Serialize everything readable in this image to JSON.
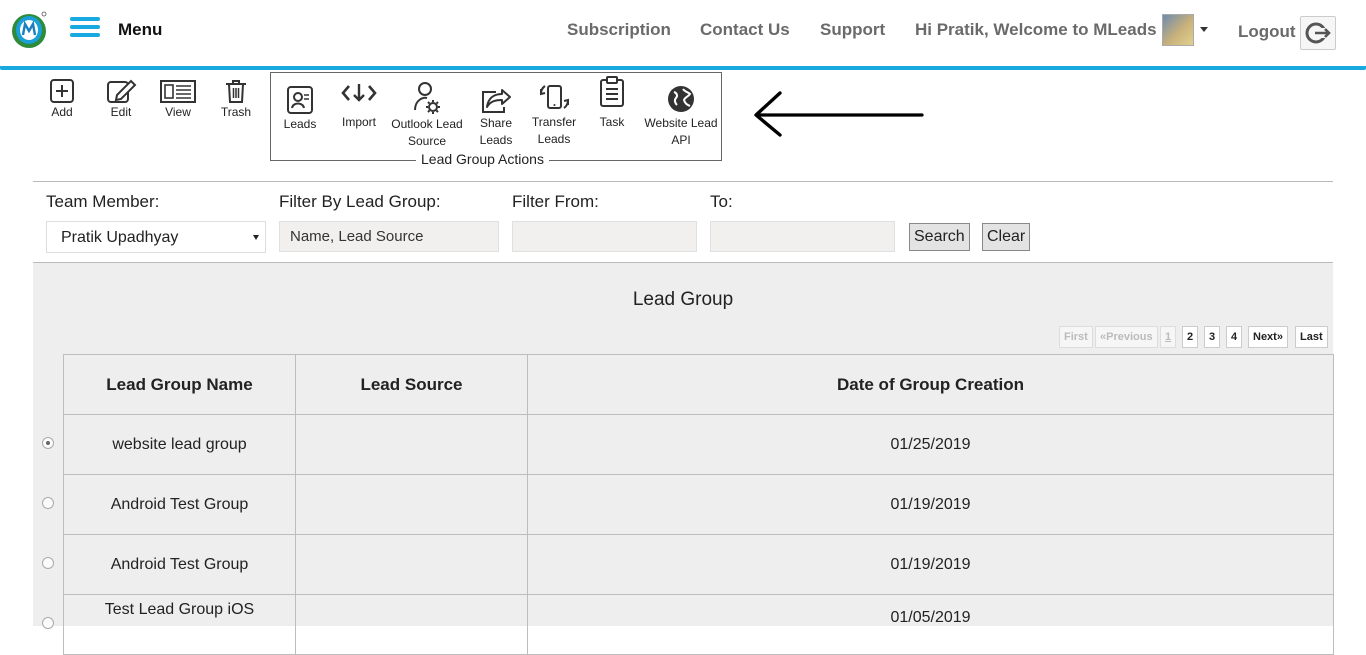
{
  "header": {
    "menu_label": "Menu",
    "nav": [
      "Subscription",
      "Contact Us",
      "Support"
    ],
    "welcome": "Hi Pratik, Welcome to MLeads",
    "logout": "Logout"
  },
  "toolbar": {
    "basic": [
      {
        "label": "Add",
        "icon": "add-icon"
      },
      {
        "label": "Edit",
        "icon": "edit-icon"
      },
      {
        "label": "View",
        "icon": "view-icon"
      },
      {
        "label": "Trash",
        "icon": "trash-icon"
      }
    ],
    "group_actions_title": "Lead Group Actions",
    "group_actions": [
      {
        "label": "Leads",
        "icon": "leads-icon"
      },
      {
        "label": "Import",
        "icon": "import-icon"
      },
      {
        "label_line1": "Outlook Lead",
        "label_line2": "Source",
        "icon": "outlook-lead-source-icon"
      },
      {
        "label_line1": "Share",
        "label_line2": "Leads",
        "icon": "share-icon"
      },
      {
        "label_line1": "Transfer",
        "label_line2": "Leads",
        "icon": "transfer-icon"
      },
      {
        "label": "Task",
        "icon": "task-icon"
      },
      {
        "label_line1": "Website Lead",
        "label_line2": "API",
        "icon": "globe-icon"
      }
    ]
  },
  "filters": {
    "team_member_label": "Team Member:",
    "team_member_value": "Pratik Upadhyay",
    "lead_group_label": "Filter By Lead Group:",
    "lead_group_placeholder": "Name, Lead Source",
    "from_label": "Filter From:",
    "to_label": "To:",
    "search": "Search",
    "clear": "Clear"
  },
  "panel": {
    "title": "Lead Group",
    "pager": [
      "First",
      "«Previous",
      "1",
      "2",
      "3",
      "4",
      "Next»",
      "Last"
    ]
  },
  "table": {
    "columns": [
      "Lead Group Name",
      "Lead Source",
      "Date of Group Creation"
    ],
    "rows": [
      {
        "name": "website lead group",
        "source": "",
        "date": "01/25/2019",
        "selected": true
      },
      {
        "name": "Android Test Group",
        "source": "",
        "date": "01/19/2019",
        "selected": false
      },
      {
        "name": "Android Test Group",
        "source": "",
        "date": "01/19/2019",
        "selected": false
      },
      {
        "name": "Test Lead Group iOS",
        "source": "",
        "date": "01/05/2019",
        "selected": false
      }
    ]
  },
  "colors": {
    "accent": "#19a9e1",
    "panel": "#eeeeee"
  }
}
